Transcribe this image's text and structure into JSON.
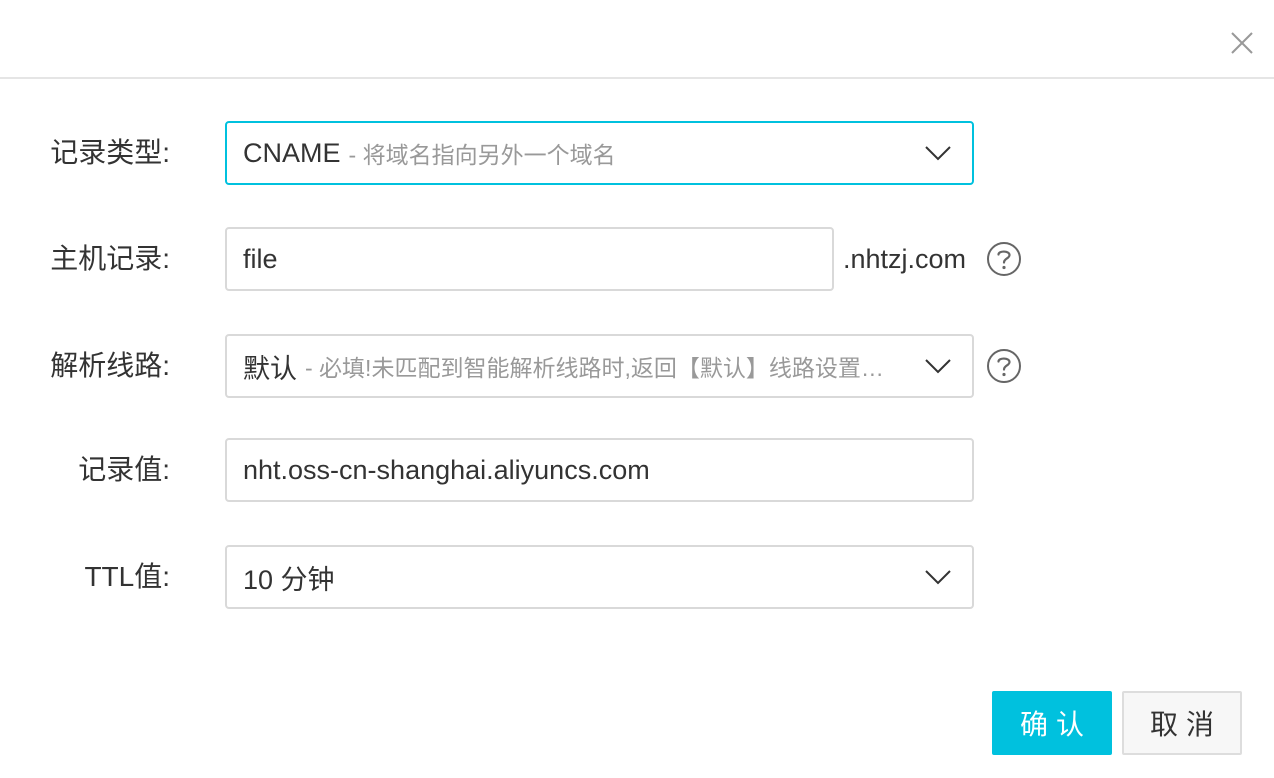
{
  "dialog": {
    "close_icon": "close-icon"
  },
  "form": {
    "record_type": {
      "label": "记录类型:",
      "value": "CNAME",
      "description": "- 将域名指向另外一个域名"
    },
    "host_record": {
      "label": "主机记录:",
      "value": "file",
      "suffix": ".nhtzj.com",
      "help_icon": "question-circle-icon"
    },
    "resolution_line": {
      "label": "解析线路:",
      "value": "默认",
      "description": "- 必填!未匹配到智能解析线路时,返回【默认】线路设置结果",
      "help_icon": "question-circle-icon"
    },
    "record_value": {
      "label": "记录值:",
      "value": "nht.oss-cn-shanghai.aliyuncs.com"
    },
    "ttl": {
      "label": "TTL值:",
      "value": "10 分钟"
    }
  },
  "footer": {
    "confirm_label": "确认",
    "cancel_label": "取消"
  },
  "colors": {
    "accent": "#00c1de",
    "border": "#d9d9d9",
    "text": "#333333",
    "muted": "#999999"
  }
}
